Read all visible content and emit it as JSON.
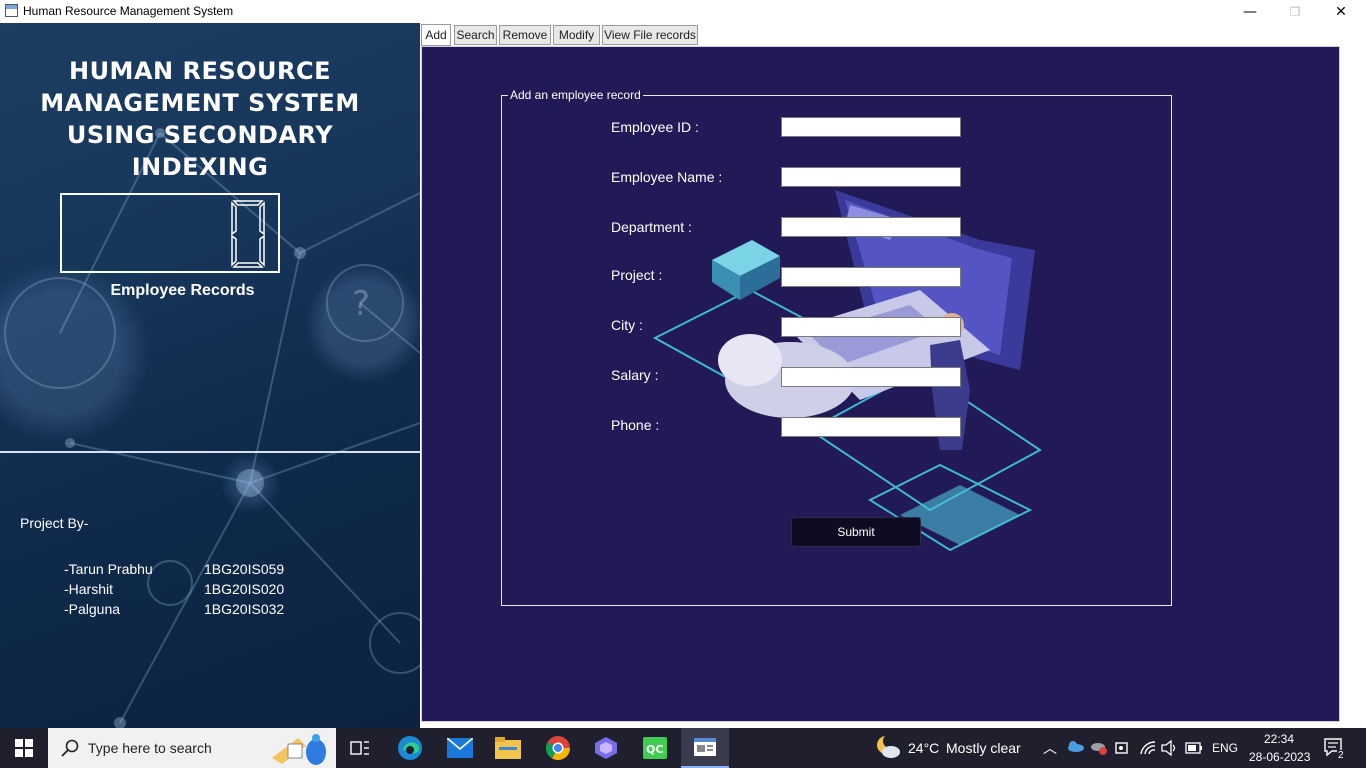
{
  "window": {
    "title": "Human Resource Management System",
    "controls": {
      "minimize": "—",
      "maximize": "❐",
      "close": "✕"
    }
  },
  "sidebar": {
    "app_title_lines": [
      "HUMAN RESOURCE",
      "MANAGEMENT SYSTEM",
      "USING SECONDARY INDEXING"
    ],
    "record_count": "0",
    "record_count_label": "Employee Records",
    "project_by": "Project By-",
    "members": [
      {
        "name": "-Tarun Prabhu",
        "usn": "1BG20IS059"
      },
      {
        "name": "-Harshit",
        "usn": "1BG20IS020"
      },
      {
        "name": "-Palguna",
        "usn": "1BG20IS032"
      }
    ]
  },
  "tabs": [
    {
      "label": "Add",
      "active": true
    },
    {
      "label": "Search",
      "active": false
    },
    {
      "label": "Remove",
      "active": false
    },
    {
      "label": "Modify",
      "active": false
    },
    {
      "label": "View File records",
      "active": false
    }
  ],
  "form": {
    "group_title": "Add an employee record",
    "fields": [
      {
        "label": "Employee ID :",
        "value": ""
      },
      {
        "label": "Employee Name :",
        "value": ""
      },
      {
        "label": "Department :",
        "value": ""
      },
      {
        "label": "Project :",
        "value": ""
      },
      {
        "label": "City :",
        "value": ""
      },
      {
        "label": "Salary :",
        "value": ""
      },
      {
        "label": "Phone :",
        "value": ""
      }
    ],
    "submit_label": "Submit"
  },
  "taskbar": {
    "search_placeholder": "Type here to search",
    "weather_temp": "24°C",
    "weather_text": "Mostly clear",
    "language": "ENG",
    "time": "22:34",
    "date": "28-06-2023",
    "notification_count": "2"
  },
  "colors": {
    "panel_bg": "#221a56",
    "sidebar_bg": "#16355a",
    "submit_bg": "#0e0c22",
    "taskbar_bg": "#1f1f2d"
  }
}
